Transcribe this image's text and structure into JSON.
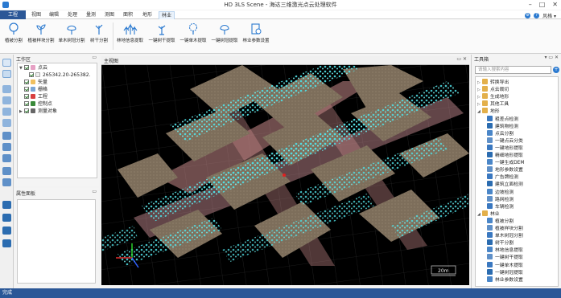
{
  "window": {
    "title": "HD 3LS Scene - 海达三维激光点云处理软件",
    "user": "风格 ▾"
  },
  "menu": {
    "items": [
      "工程",
      "视图",
      "编辑",
      "处理",
      "量测",
      "测图",
      "面积",
      "地形",
      "林业"
    ],
    "active_index": 8
  },
  "ribbon": {
    "buttons": [
      "植被分割",
      "植被样块分割",
      "单木树冠分割",
      "树干分割",
      "林地信息提取",
      "一键树干提取",
      "一键单木提取",
      "一键树冠提取",
      "林业参数设置"
    ]
  },
  "work_area": {
    "title": "工作区",
    "pin": "📌",
    "tree": [
      {
        "label": "点云",
        "checked": true,
        "level": 0,
        "expand": "▼"
      },
      {
        "label": "265342.20-265382.",
        "checked": true,
        "level": 1,
        "expand": ""
      },
      {
        "label": "矢量",
        "checked": true,
        "level": 0,
        "expand": ""
      },
      {
        "label": "栅格",
        "checked": true,
        "level": 0,
        "expand": ""
      },
      {
        "label": "工程",
        "checked": true,
        "level": 0,
        "expand": ""
      },
      {
        "label": "控制点",
        "checked": true,
        "level": 0,
        "expand": ""
      },
      {
        "label": "测量对象",
        "checked": true,
        "level": 0,
        "expand": "▶"
      }
    ]
  },
  "attr_panel": {
    "title": "属性面板"
  },
  "viewport": {
    "tab_title": "主视图",
    "scale_label": "20m"
  },
  "toolbox": {
    "title": "工具箱",
    "search_placeholder": "请输入搜索内容",
    "items": [
      {
        "label": "转换导出",
        "level": 0,
        "expand": "▷"
      },
      {
        "label": "点云裁切",
        "level": 0,
        "expand": "▷"
      },
      {
        "label": "生成地形",
        "level": 0,
        "expand": "▷"
      },
      {
        "label": "其他工具",
        "level": 0,
        "expand": "▷"
      },
      {
        "label": "地形",
        "level": 0,
        "expand": "◢"
      },
      {
        "label": "粗差点检测",
        "level": 1,
        "expand": ""
      },
      {
        "label": "建筑物检测",
        "level": 1,
        "expand": ""
      },
      {
        "label": "点云分割",
        "level": 1,
        "expand": ""
      },
      {
        "label": "一键点云分类",
        "level": 1,
        "expand": ""
      },
      {
        "label": "一键地形提取",
        "level": 1,
        "expand": ""
      },
      {
        "label": "精细地形提取",
        "level": 1,
        "expand": ""
      },
      {
        "label": "一键生成DEM",
        "level": 1,
        "expand": ""
      },
      {
        "label": "地形参数设置",
        "level": 1,
        "expand": ""
      },
      {
        "label": "广告牌检测",
        "level": 1,
        "expand": ""
      },
      {
        "label": "建筑立面检测",
        "level": 1,
        "expand": ""
      },
      {
        "label": "边坡检测",
        "level": 1,
        "expand": ""
      },
      {
        "label": "路网检测",
        "level": 1,
        "expand": ""
      },
      {
        "label": "车辆检测",
        "level": 1,
        "expand": ""
      },
      {
        "label": "林业",
        "level": 0,
        "expand": "◢"
      },
      {
        "label": "植被分割",
        "level": 1,
        "expand": ""
      },
      {
        "label": "植被样块分割",
        "level": 1,
        "expand": ""
      },
      {
        "label": "单木树冠分割",
        "level": 1,
        "expand": ""
      },
      {
        "label": "树干分割",
        "level": 1,
        "expand": ""
      },
      {
        "label": "林地信息提取",
        "level": 1,
        "expand": ""
      },
      {
        "label": "一键树干提取",
        "level": 1,
        "expand": ""
      },
      {
        "label": "一键单木提取",
        "level": 1,
        "expand": ""
      },
      {
        "label": "一键树冠提取",
        "level": 1,
        "expand": ""
      },
      {
        "label": "林业参数设置",
        "level": 1,
        "expand": ""
      }
    ]
  },
  "status": {
    "text": "完成"
  },
  "colors": {
    "accent": "#2b5797",
    "status_bar": "#2b5797",
    "vegetation": "#4fe0e6",
    "building": "#8a7a66",
    "road": "#e8a0a0"
  }
}
